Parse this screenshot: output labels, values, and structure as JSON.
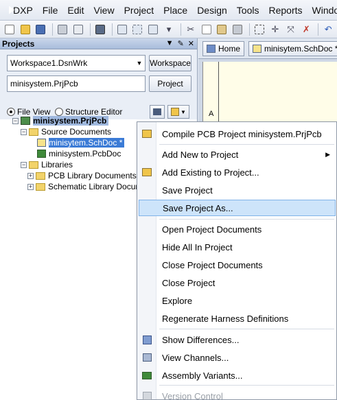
{
  "menubar": {
    "app": "DXP",
    "items": [
      "File",
      "Edit",
      "View",
      "Project",
      "Place",
      "Design",
      "Tools",
      "Reports",
      "Window"
    ]
  },
  "panel": {
    "title": "Projects",
    "workspace_combo": "Workspace1.DsnWrk",
    "workspace_button": "Workspace",
    "project_field": "minisystem.PrjPcb",
    "project_button": "Project",
    "radio_file_view": "File View",
    "radio_structure_editor": "Structure Editor"
  },
  "tree": {
    "project": "minisystem.PrjPcb",
    "source_documents": "Source Documents",
    "schdoc": "minisytem.SchDoc *",
    "pcbdoc": "minisystem.PcbDoc",
    "libraries": "Libraries",
    "pcb_lib_docs": "PCB Library Documents",
    "sch_lib_docs": "Schematic Library Documents"
  },
  "docarea": {
    "tab_home": "Home",
    "tab_schdoc": "minisytem.SchDoc *",
    "row_label": "A"
  },
  "context_menu": {
    "compile": "Compile PCB Project minisystem.PrjPcb",
    "add_new": "Add New to Project",
    "add_existing": "Add Existing to Project...",
    "save_project": "Save Project",
    "save_project_as": "Save Project As...",
    "open_docs": "Open Project Documents",
    "hide_all": "Hide All In Project",
    "close_docs": "Close Project Documents",
    "close_project": "Close Project",
    "explore": "Explore",
    "regenerate": "Regenerate Harness Definitions",
    "show_diff": "Show Differences...",
    "view_channels": "View Channels...",
    "assembly_variants": "Assembly Variants...",
    "version_control": "Version Control"
  }
}
